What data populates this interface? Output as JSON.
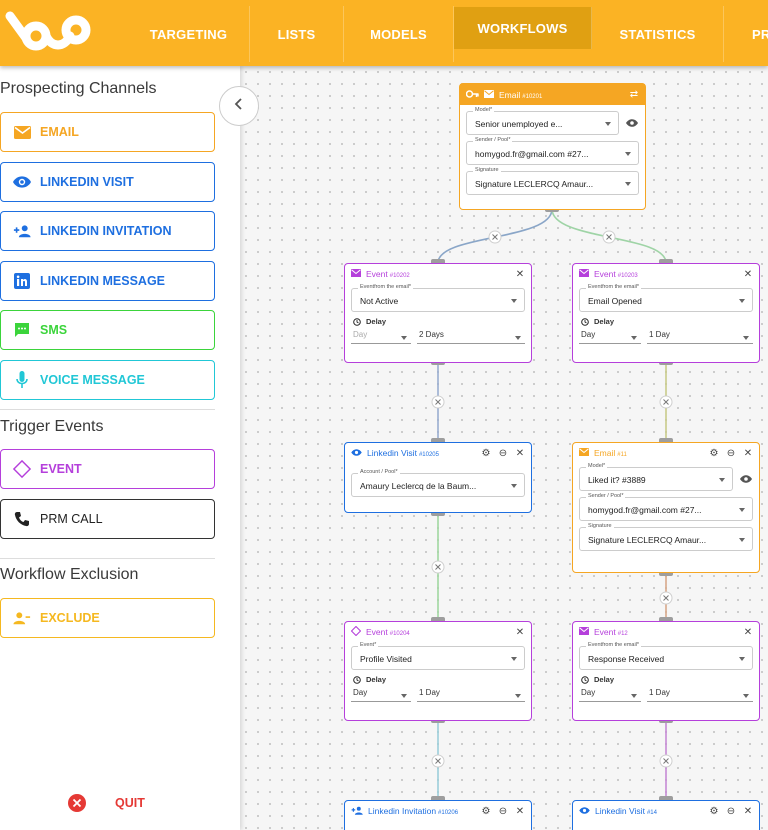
{
  "nav": {
    "items": [
      {
        "label": "TARGETING",
        "active": false
      },
      {
        "label": "LISTS",
        "active": false
      },
      {
        "label": "MODELS",
        "active": false
      },
      {
        "label": "WORKFLOWS",
        "active": true
      },
      {
        "label": "STATISTICS",
        "active": false
      },
      {
        "label": "PR",
        "active": false
      }
    ]
  },
  "colors": {
    "brand": "#fbb324",
    "email": "#f5a623",
    "linkedin": "#1e6fe0",
    "sms": "#3bd43b",
    "voice": "#21c7d6",
    "event": "#b53fdb",
    "prm": "#333333",
    "exclude": "#f5b820",
    "quit": "#e53935"
  },
  "sidebar": {
    "prospecting_title": "Prospecting Channels",
    "channels": [
      {
        "label": "EMAIL",
        "icon": "envelope-icon"
      },
      {
        "label": "LINKEDIN VISIT",
        "icon": "eye-icon"
      },
      {
        "label": "LINKEDIN INVITATION",
        "icon": "person-add-icon"
      },
      {
        "label": "LINKEDIN MESSAGE",
        "icon": "linkedin-icon"
      },
      {
        "label": "SMS",
        "icon": "sms-icon"
      },
      {
        "label": "VOICE MESSAGE",
        "icon": "microphone-icon"
      }
    ],
    "trigger_title": "Trigger Events",
    "triggers": [
      {
        "label": "EVENT",
        "icon": "diamond-icon"
      },
      {
        "label": "PRM CALL",
        "icon": "phone-icon"
      }
    ],
    "exclusion_title": "Workflow Exclusion",
    "exclusions": [
      {
        "label": "EXCLUDE",
        "icon": "person-remove-icon"
      }
    ],
    "quit_label": "QUIT"
  },
  "workflow": {
    "email_root": {
      "title": "Email",
      "id": "#10201",
      "model_label": "Model*",
      "model_value": "Senior unemployed e...",
      "sender_label": "Sender / Pool*",
      "sender_value": "homygod.fr@gmail.com #27...",
      "signature_label": "Signature",
      "signature_value": "Signature LECLERCQ Amaur..."
    },
    "event_a": {
      "title": "Event",
      "id": "#10202",
      "field_label": "Eventfrom the email*",
      "field_value": "Not Active",
      "delay_label": "Delay",
      "unit": "Day",
      "amount": "2 Days"
    },
    "event_b": {
      "title": "Event",
      "id": "#10203",
      "field_label": "Eventfrom the email*",
      "field_value": "Email Opened",
      "delay_label": "Delay",
      "unit": "Day",
      "amount": "1 Day"
    },
    "linkedin_visit": {
      "title": "Linkedin Visit",
      "id": "#10205",
      "field_label": "Account / Pool*",
      "field_value": "Amaury Leclercq de la Baum..."
    },
    "email_11": {
      "title": "Email",
      "id": "#11",
      "model_label": "Model*",
      "model_value": "Liked it? #3889",
      "sender_label": "Sender / Pool*",
      "sender_value": "homygod.fr@gmail.com #27...",
      "signature_label": "Signature",
      "signature_value": "Signature LECLERCQ Amaur..."
    },
    "event_c": {
      "title": "Event",
      "id": "#10204",
      "field_label": "Event*",
      "field_value": "Profile Visited",
      "delay_label": "Delay",
      "unit": "Day",
      "amount": "1 Day"
    },
    "event_12": {
      "title": "Event",
      "id": "#12",
      "field_label": "Eventfrom the email*",
      "field_value": "Response Received",
      "delay_label": "Delay",
      "unit": "Day",
      "amount": "1 Day"
    },
    "linkedin_invitation": {
      "title": "Linkedin Invitation",
      "id": "#10206"
    },
    "linkedin_visit_14": {
      "title": "Linkedin Visit",
      "id": "#14"
    }
  }
}
